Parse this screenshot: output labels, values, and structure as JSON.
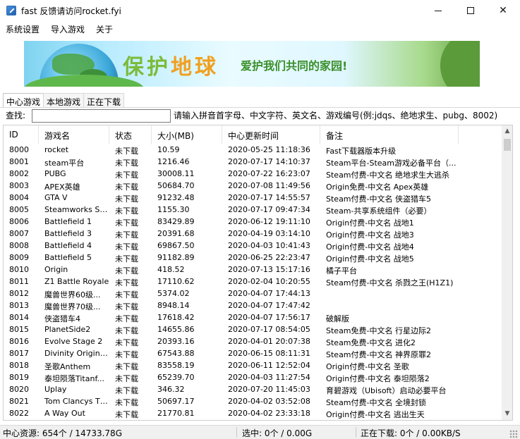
{
  "window": {
    "title": "fast 反馈请访问rocket.fyi",
    "controls": [
      "minimize",
      "maximize",
      "close"
    ],
    "close_glyph": "✕"
  },
  "menu": [
    "系统设置",
    "导入游戏",
    "关于"
  ],
  "banner": {
    "slogan_part1": "保护",
    "slogan_part2": "地球",
    "slogan_small": "爱护我们共同的家园!"
  },
  "tabs": [
    {
      "label": "中心游戏",
      "active": true
    },
    {
      "label": "本地游戏",
      "active": false
    },
    {
      "label": "正在下载",
      "active": false
    }
  ],
  "search": {
    "label": "查找:",
    "value": "",
    "hint": "请输入拼音首字母、中文字符、英文名、游戏编号(例:jdqs、绝地求生、pubg、8002)"
  },
  "table": {
    "columns": [
      "ID",
      "游戏名",
      "状态",
      "大小(MB)",
      "中心更新时间",
      "备注"
    ],
    "rows": [
      [
        "8000",
        "rocket",
        "未下载",
        "10.59",
        "2020-05-25 11:18:36",
        "Fast下载器版本升级"
      ],
      [
        "8001",
        "steam平台",
        "未下载",
        "1216.46",
        "2020-07-17 14:10:37",
        "Steam平台-Steam游戏必备平台（..."
      ],
      [
        "8002",
        "PUBG",
        "未下载",
        "30008.11",
        "2020-07-22 16:23:07",
        "Steam付费-中文名 绝地求生大逃杀"
      ],
      [
        "8003",
        "APEX英雄",
        "未下载",
        "50684.70",
        "2020-07-08 11:49:56",
        "Origin免费-中文名 Apex英雄"
      ],
      [
        "8004",
        "GTA V",
        "未下载",
        "91232.48",
        "2020-07-17 14:55:57",
        "Steam付费-中文名 侠盗猎车5"
      ],
      [
        "8005",
        "Steamworks Sh...",
        "未下载",
        "1155.30",
        "2020-07-17 09:47:34",
        "Steam-共享系统组件（必要）"
      ],
      [
        "8006",
        "Battlefield 1",
        "未下载",
        "83429.89",
        "2020-06-12 19:11:10",
        "Origin付费-中文名 战地1"
      ],
      [
        "8007",
        "Battlefield 3",
        "未下载",
        "20391.68",
        "2020-04-19 03:14:10",
        "Origin付费-中文名 战地3"
      ],
      [
        "8008",
        "Battlefield 4",
        "未下载",
        "69867.50",
        "2020-04-03 10:41:43",
        "Origin付费-中文名 战地4"
      ],
      [
        "8009",
        "Battlefield 5",
        "未下载",
        "91182.89",
        "2020-06-25 22:23:47",
        "Origin付费-中文名 战地5"
      ],
      [
        "8010",
        "Origin",
        "未下载",
        "418.52",
        "2020-07-13 15:17:16",
        "橘子平台"
      ],
      [
        "8011",
        "Z1 Battle Royale",
        "未下载",
        "17110.62",
        "2020-02-04 10:20:55",
        "Steam付费-中文名 杀戮之王(H1Z1)"
      ],
      [
        "8012",
        "魔兽世界60级...",
        "未下载",
        "5374.02",
        "2020-04-07 17:44:13",
        ""
      ],
      [
        "8013",
        "魔兽世界70级...",
        "未下载",
        "8948.14",
        "2020-04-07 17:47:42",
        ""
      ],
      [
        "8014",
        "侠盗猎车4",
        "未下载",
        "17618.42",
        "2020-04-07 17:56:17",
        "破解版"
      ],
      [
        "8015",
        "PlanetSide2",
        "未下载",
        "14655.86",
        "2020-07-17 08:54:05",
        "Steam免费-中文名 行星边际2"
      ],
      [
        "8016",
        "Evolve Stage 2",
        "未下载",
        "20393.16",
        "2020-04-01 20:07:38",
        "Steam免费-中文名 进化2"
      ],
      [
        "8017",
        "Divinity Original...",
        "未下载",
        "67543.88",
        "2020-06-15 08:11:31",
        "Steam付费-中文名 神界原罪2"
      ],
      [
        "8018",
        "圣歌Anthem",
        "未下载",
        "83558.19",
        "2020-06-11 12:52:04",
        "Origin付费-中文名 圣歌"
      ],
      [
        "8019",
        "泰坦陨落Titanf...",
        "未下载",
        "65239.70",
        "2020-04-03 11:27:54",
        "Origin付费-中文名 泰坦陨落2"
      ],
      [
        "8020",
        "Uplay",
        "未下载",
        "346.32",
        "2020-07-20 11:45:03",
        "育碧游戏（Ubisoft）启动必要平台"
      ],
      [
        "8021",
        "Tom Clancys Th...",
        "未下载",
        "50697.17",
        "2020-04-02 03:52:08",
        "Steam付费-中文名 全境封锁"
      ],
      [
        "8022",
        "A Way Out",
        "未下载",
        "21770.81",
        "2020-04-02 23:33:18",
        "Origin付费-中文名 逃出生天"
      ]
    ]
  },
  "status": {
    "center": "中心资源: 654个 / 14733.78G",
    "selected": "选中: 0个 / 0.00G",
    "downloading": "正在下载: 0个 / 0.00KB/S"
  }
}
